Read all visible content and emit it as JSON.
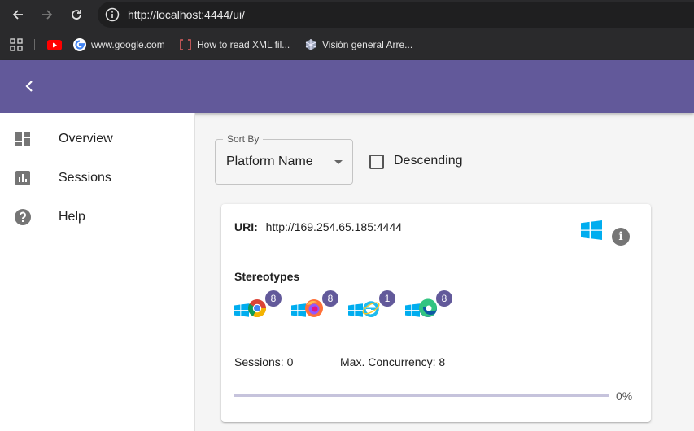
{
  "browser": {
    "url": "http://localhost:4444/ui/",
    "bookmarks": [
      {
        "label": "",
        "icon": "youtube-icon"
      },
      {
        "label": "www.google.com",
        "icon": "google-icon"
      },
      {
        "label": "How to read XML fil...",
        "icon": "bracket-icon"
      },
      {
        "label": "Visión general Arre...",
        "icon": "globe-icon"
      }
    ]
  },
  "sidebar": {
    "items": [
      {
        "label": "Overview",
        "icon": "dashboard-icon"
      },
      {
        "label": "Sessions",
        "icon": "bar-chart-icon"
      },
      {
        "label": "Help",
        "icon": "help-icon"
      }
    ]
  },
  "sort": {
    "legend": "Sort By",
    "value": "Platform Name",
    "descending_label": "Descending"
  },
  "node": {
    "uri_label": "URI:",
    "uri": "http://169.254.65.185:4444",
    "stereotypes_title": "Stereotypes",
    "stereotypes": [
      {
        "platform": "windows-icon",
        "browser": "chrome-icon",
        "count": "8"
      },
      {
        "platform": "windows-icon",
        "browser": "firefox-icon",
        "count": "8"
      },
      {
        "platform": "windows-icon",
        "browser": "internet-explorer-icon",
        "count": "1"
      },
      {
        "platform": "windows-icon",
        "browser": "edge-icon",
        "count": "8"
      }
    ],
    "sessions_text": "Sessions: 0",
    "concurrency_text": "Max. Concurrency: 8",
    "load_percent": 0,
    "load_text": "0%"
  },
  "colors": {
    "primary": "#62599a",
    "windows_blue": "#00adef"
  }
}
